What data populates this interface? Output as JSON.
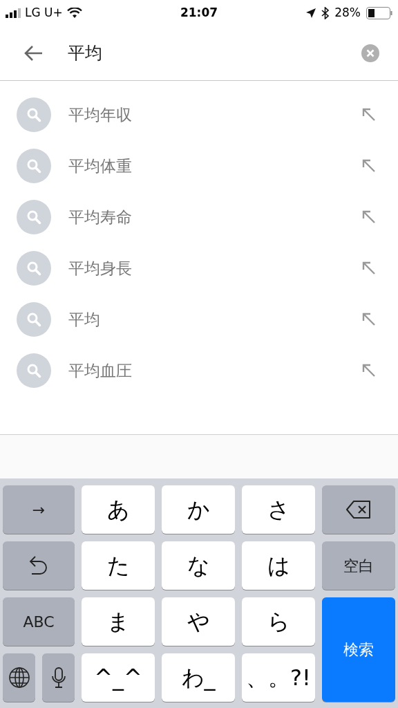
{
  "status_bar": {
    "carrier": "LG U+",
    "time": "21:07",
    "battery": "28%"
  },
  "search": {
    "value": "平均"
  },
  "suggestions": [
    {
      "text": "平均年収"
    },
    {
      "text": "平均体重"
    },
    {
      "text": "平均寿命"
    },
    {
      "text": "平均身長"
    },
    {
      "text": "平均"
    },
    {
      "text": "平均血圧"
    }
  ],
  "keyboard": {
    "keys": [
      {
        "kind": "function",
        "label": "→"
      },
      {
        "kind": "char",
        "label": "あ"
      },
      {
        "kind": "char",
        "label": "か"
      },
      {
        "kind": "char",
        "label": "さ"
      },
      {
        "kind": "delete"
      },
      {
        "kind": "undo"
      },
      {
        "kind": "char",
        "label": "た"
      },
      {
        "kind": "char",
        "label": "な"
      },
      {
        "kind": "char",
        "label": "は"
      },
      {
        "kind": "function",
        "label": "空白"
      },
      {
        "kind": "function",
        "label": "ABC"
      },
      {
        "kind": "char",
        "label": "ま"
      },
      {
        "kind": "char",
        "label": "や"
      },
      {
        "kind": "char",
        "label": "ら"
      },
      {
        "kind": "action",
        "label": "検索"
      },
      {
        "kind": "globe"
      },
      {
        "kind": "mic"
      },
      {
        "kind": "char",
        "label": "^_^"
      },
      {
        "kind": "char",
        "label": "わ_"
      },
      {
        "kind": "char",
        "label": "、。?!"
      }
    ]
  }
}
